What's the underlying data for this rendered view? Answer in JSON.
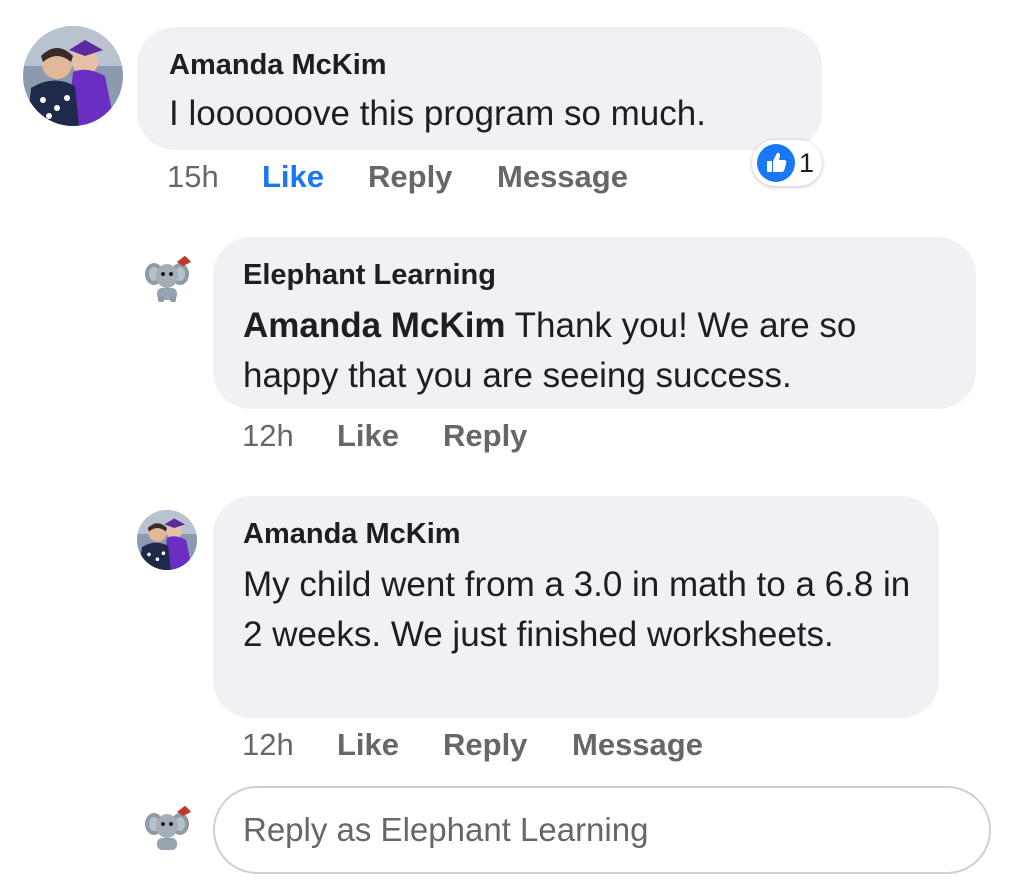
{
  "comments": [
    {
      "author": "Amanda McKim",
      "text": "I loooooove this program so much.",
      "time": "15h",
      "like_label": "Like",
      "reply_label": "Reply",
      "message_label": "Message",
      "reaction_count": "1",
      "liked": true
    },
    {
      "author": "Elephant Learning",
      "mention": "Amanda McKim",
      "text": " Thank you!  We are so happy that you are seeing success.",
      "time": "12h",
      "like_label": "Like",
      "reply_label": "Reply"
    },
    {
      "author": "Amanda McKim",
      "text": "My child went from a 3.0 in math to a 6.8 in 2 weeks. We just finished worksheets.",
      "time": "12h",
      "like_label": "Like",
      "reply_label": "Reply",
      "message_label": "Message"
    }
  ],
  "reply_box": {
    "placeholder": "Reply as Elephant Learning"
  },
  "icons": {
    "reaction": "like-thumbs-up-icon",
    "user_avatar": "amanda-avatar",
    "page_avatar": "elephant-avatar"
  },
  "colors": {
    "accent": "#1877f2",
    "bubble": "#f0f1f5",
    "muted_text": "#65676b"
  }
}
